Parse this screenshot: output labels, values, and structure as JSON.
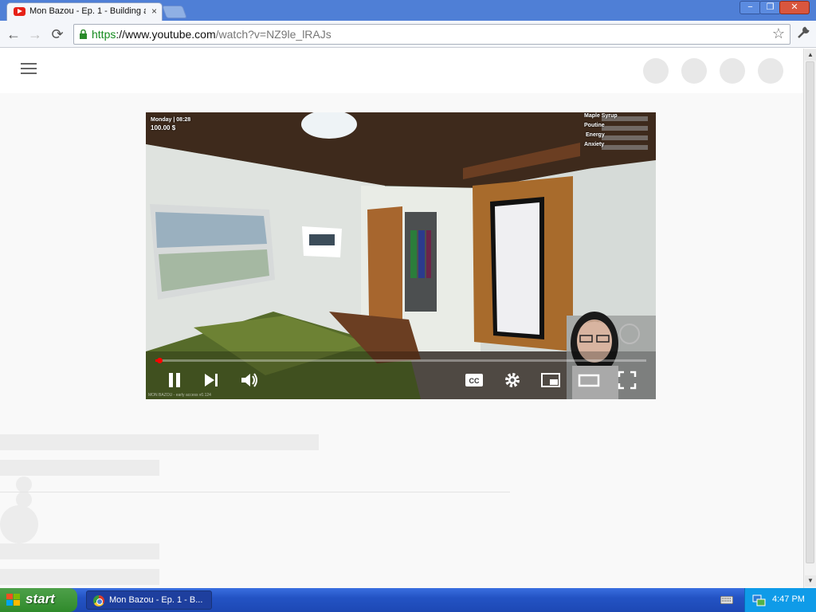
{
  "browser": {
    "tab_title": "Mon Bazou - Ep. 1 - Building ar",
    "tab_close": "×",
    "window_min": "−",
    "window_max": "❐",
    "window_close": "✕",
    "back": "←",
    "forward": "→",
    "reload": "⟳",
    "url_scheme": "https",
    "url_host": "://www.youtube.com",
    "url_path": "/watch?v=NZ9le_lRAJs",
    "bookmark_icon": "star-icon",
    "bookmark_glyph": "☆",
    "menu_icon": "wrench-icon",
    "menu_glyph": "🔧"
  },
  "video": {
    "hud": {
      "day_time": "Monday | 08:28",
      "money": "100.00 $",
      "stats": [
        "Maple Syrup",
        "Poutine",
        "Energy",
        "Anxiety"
      ]
    },
    "watermark": "MON BAZOU - early access v0.124",
    "progress": 0.008,
    "controls": [
      "pause",
      "next",
      "volume",
      "captions",
      "settings",
      "miniplayer",
      "theater",
      "fullscreen"
    ],
    "cc_label": "CC"
  },
  "taskbar": {
    "start_label": "start",
    "window_item": "Mon Bazou - Ep. 1 - B...",
    "clock": "4:47 PM"
  },
  "colors": {
    "titlebar": "#4f7fd6",
    "https_green": "#148a1e",
    "progress_red": "#ff0000",
    "taskbar_blue": "#2353c4",
    "start_green": "#2f8a2b"
  }
}
